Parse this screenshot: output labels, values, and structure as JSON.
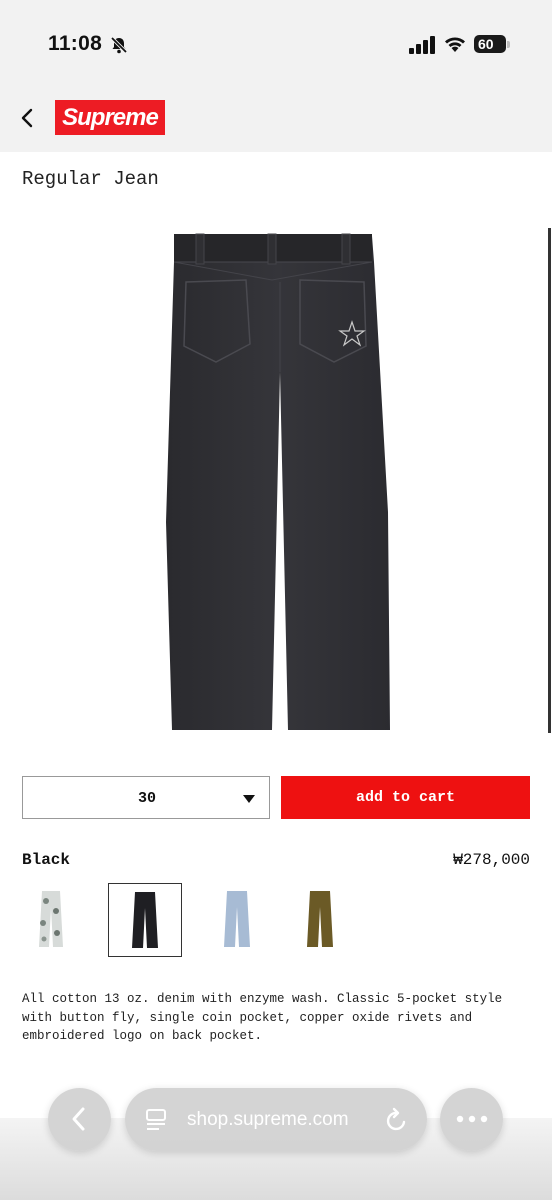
{
  "status_bar": {
    "time": "11:08",
    "battery": "60"
  },
  "header": {
    "logo": "Supreme"
  },
  "product": {
    "title": "Regular Jean",
    "size_selected": "30",
    "add_to_cart_label": "add to cart",
    "color_name": "Black",
    "price": "₩278,000",
    "swatches": [
      "floral",
      "black",
      "light-blue",
      "olive"
    ],
    "description": "All cotton 13 oz. denim with enzyme wash. Classic 5-pocket style with button fly, single coin pocket, copper oxide rivets and embroidered logo on back pocket."
  },
  "browser": {
    "url": "shop.supreme.com"
  },
  "colors": {
    "brand_red": "#ed1c24",
    "cart_red": "#ee1111"
  }
}
